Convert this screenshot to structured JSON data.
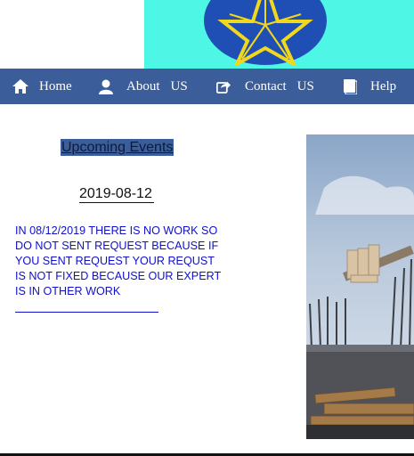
{
  "banner": {
    "bg_color": "#4ef6e6",
    "emblem_icon": "ethiopian-emblem"
  },
  "nav": {
    "bg_color": "#3b5e9a",
    "items": [
      {
        "icon": "home-icon",
        "label": "Home"
      },
      {
        "icon": "user-icon",
        "label": "About",
        "label2": "US"
      },
      {
        "icon": "share-icon",
        "label": "Contact",
        "label2": "US"
      },
      {
        "icon": "book-icon",
        "label": "Help"
      }
    ]
  },
  "events": {
    "title": "Upcoming Events",
    "date": "2019-08-12",
    "text": "IN 08/12/2019 THERE IS NO WORK SO DO NOT SENT REQUEST BECAUSE IF YOU SENT REQUEST YOUR REQUST IS NOT FIXED BECAUSE OUR EXPERT IS IN OTHER WORK",
    "text_color": "#1010cc"
  },
  "photo": {
    "subject": "construction-site-image"
  }
}
